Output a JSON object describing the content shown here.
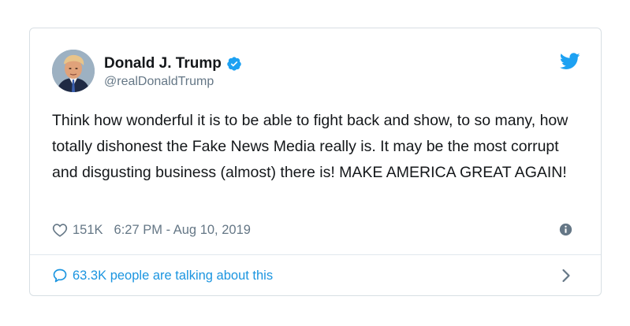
{
  "tweet": {
    "author": {
      "display_name": "Donald J. Trump",
      "handle": "@realDonaldTrump",
      "verified": true
    },
    "text": "Think how wonderful it is to be able to fight back and show, to so many, how totally dishonest the Fake News Media really is. It may be the most corrupt and disgusting business (almost) there is! MAKE AMERICA GREAT AGAIN!",
    "likes": "151K",
    "timestamp": "6:27 PM - Aug 10, 2019",
    "conversation": "63.3K people are talking about this"
  },
  "icons": {
    "like": "heart-icon",
    "info": "info-icon",
    "brand": "twitter-bird-icon",
    "verified": "verified-badge-icon",
    "conversation": "speech-bubble-icon",
    "navigate": "chevron-right-icon"
  },
  "colors": {
    "brand_blue": "#1da1f2",
    "link_blue": "#1b95e0",
    "text_primary": "#14171a",
    "text_secondary": "#657786",
    "border": "#d8dfe4"
  }
}
